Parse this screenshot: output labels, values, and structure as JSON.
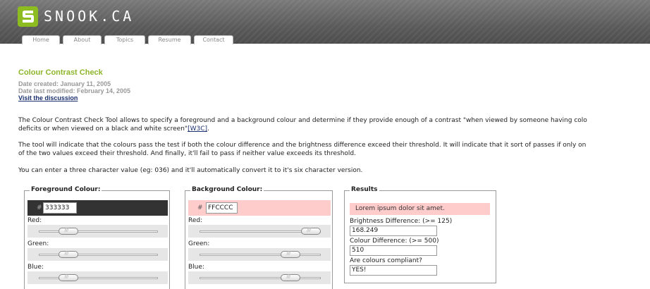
{
  "header": {
    "logo_text": "SNOOK.CA",
    "tabs": [
      "Home",
      "About",
      "Topics",
      "Resume",
      "Contact"
    ]
  },
  "article": {
    "title": "Colour Contrast Check",
    "date_created": "Date created: January 11, 2005",
    "date_modified": "Date last modified: February 14, 2005",
    "discussion_link": "Visit the discussion",
    "p1_line1": "The Colour Contrast Check Tool allows to specify a foreground and a background colour and determine if they provide enough of a contrast \"when viewed by someone having colo",
    "p1_line2_start": "deficits or when viewed on a black and white screen\"",
    "w3c_link": "[W3C]",
    "p1_line2_end": ".",
    "p2_line1": "The tool will indicate that the colours pass the test if both the colour difference and the brightness difference exceed their threshold. It will indicate that it sort of passes if only on",
    "p2_line2": "of the two values exceed their threshold. And finally, it'll fail to pass if neither value exceeds its threshold.",
    "p3": "You can enter a three character value (eg: 036) and it'll automatically convert it to it's six character version."
  },
  "foreground": {
    "legend": "Foreground Colour:",
    "hash": "#",
    "hex": "333333",
    "red_label": "Red:",
    "green_label": "Green:",
    "blue_label": "Blue:",
    "red_level": 0.2,
    "green_level": 0.2,
    "blue_level": 0.2,
    "swatch_color": "#333333"
  },
  "background": {
    "legend": "Background Colour:",
    "hash": "#",
    "hex": "FFCCCC",
    "red_label": "Red:",
    "green_label": "Green:",
    "blue_label": "Blue:",
    "red_level": 1.0,
    "green_level": 0.8,
    "blue_level": 0.8,
    "swatch_color": "#ffcccc"
  },
  "results": {
    "legend": "Results",
    "sample_text": "Lorem ipsum dolor sit amet.",
    "brightness_label": "Brightness Difference: (>= 125)",
    "brightness_value": "168.249",
    "colour_label": "Colour Difference: (>= 500)",
    "colour_value": "510",
    "compliant_label": "Are colours compliant?",
    "compliant_value": "YES!"
  },
  "colors": {
    "accent": "#8db52a",
    "link": "#1a2f6e"
  }
}
